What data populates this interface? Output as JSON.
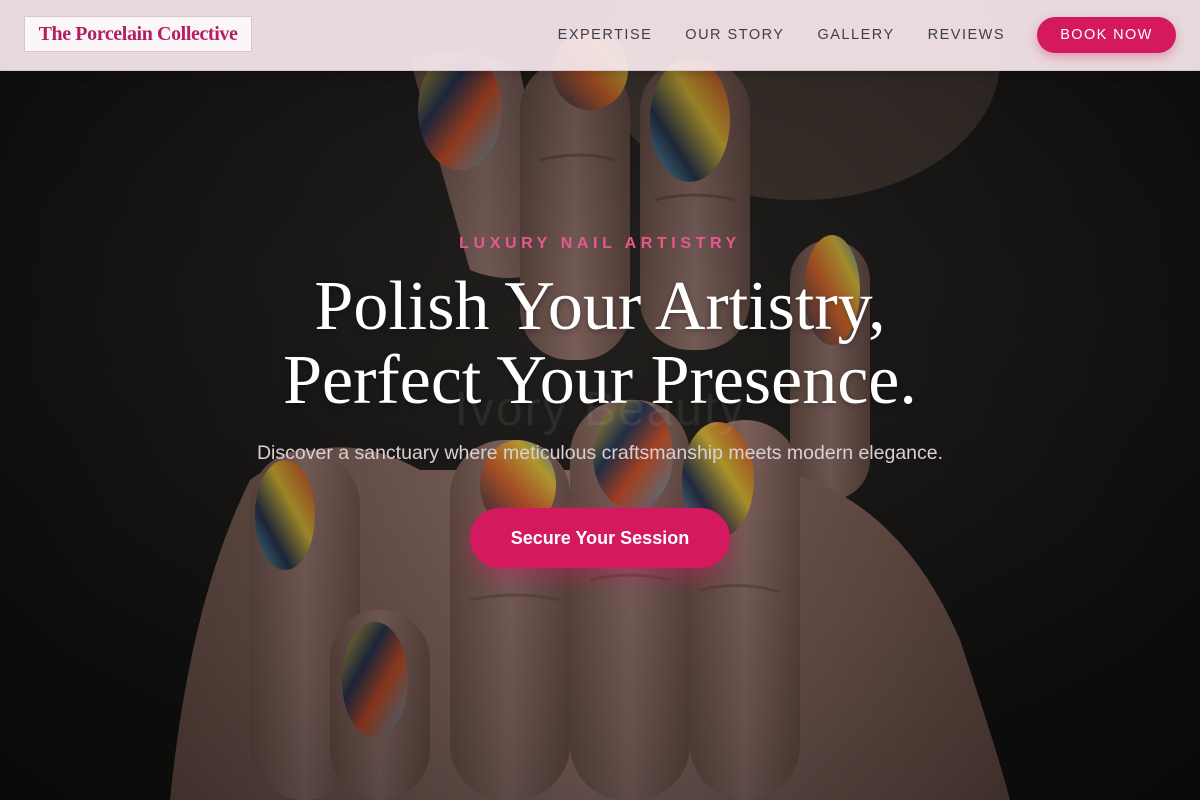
{
  "brand": {
    "name": "The Porcelain Collective",
    "accent_color": "#d4195f",
    "logo_text_color": "#b51f5f",
    "eyebrow_color": "#e8578f"
  },
  "nav": {
    "links": [
      {
        "label": "EXPERTISE"
      },
      {
        "label": "OUR STORY"
      },
      {
        "label": "GALLERY"
      },
      {
        "label": "REVIEWS"
      }
    ],
    "cta_label": "BOOK NOW"
  },
  "hero": {
    "background_image": "hands-with-multicolor-abstract-nail-art-photo",
    "eyebrow": "LUXURY NAIL ARTISTRY",
    "headline_line1": "Polish Your Artistry,",
    "headline_line2": "Perfect Your Presence.",
    "watermark_text": "Ivory Beauty",
    "subtitle": "Discover a sanctuary where meticulous craftsmanship meets modern elegance.",
    "cta_label": "Secure Your Session"
  }
}
